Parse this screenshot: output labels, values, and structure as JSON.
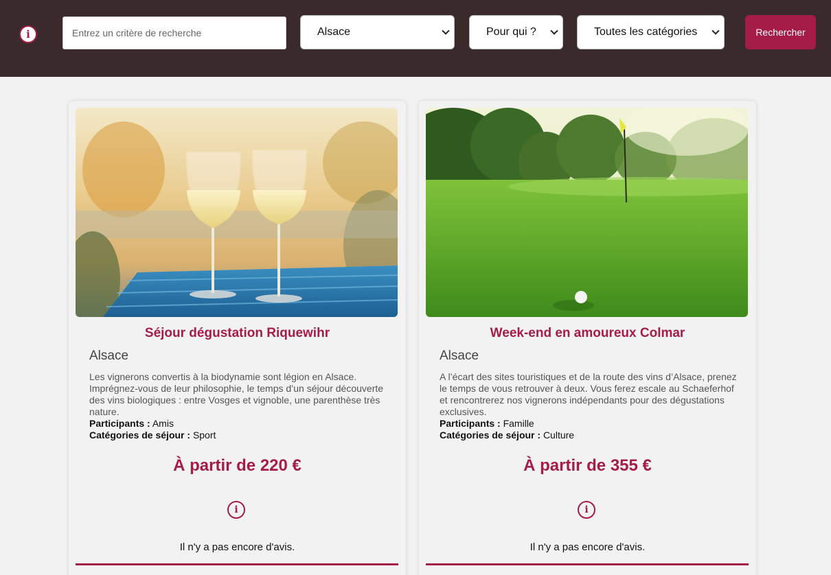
{
  "search": {
    "placeholder": "Entrez un critère de recherche",
    "region_selected": "Alsace",
    "who_selected": "Pour qui ?",
    "category_selected": "Toutes les catégories",
    "button_label": "Rechercher"
  },
  "cards": [
    {
      "title": "Séjour dégustation Riquewihr",
      "region": "Alsace",
      "description": "Les vignerons convertis à la biodynamie sont légion en Alsace. Imprégnez-vous de leur philosophie, le temps d’un séjour découverte des vins biologiques : entre Vosges et vignoble, une parenthèse très nature.",
      "participants_label": "Participants :",
      "participants": "Amis",
      "category_label": "Catégories de séjour :",
      "category": "Sport",
      "price": "À partir de 220 €",
      "reviews": "Il n'y a pas encore d'avis."
    },
    {
      "title": "Week-end en amoureux Colmar",
      "region": "Alsace",
      "description": "A l’écart des sites touristiques et de la route des vins d’Alsace, prenez le temps de vous retrouver à deux. Vous ferez escale au Schaeferhof et rencontrerez nos vignerons indépendants pour des dégustations exclusives.",
      "participants_label": "Participants :",
      "participants": "Famille",
      "category_label": "Catégories de séjour :",
      "category": "Culture",
      "price": "À partir de 355 €",
      "reviews": "Il n'y a pas encore d'avis."
    }
  ],
  "info_glyph": "i",
  "colors": {
    "header_bg": "#3b2a2b",
    "accent": "#a51d46",
    "page_bg": "#f2f2f2"
  }
}
